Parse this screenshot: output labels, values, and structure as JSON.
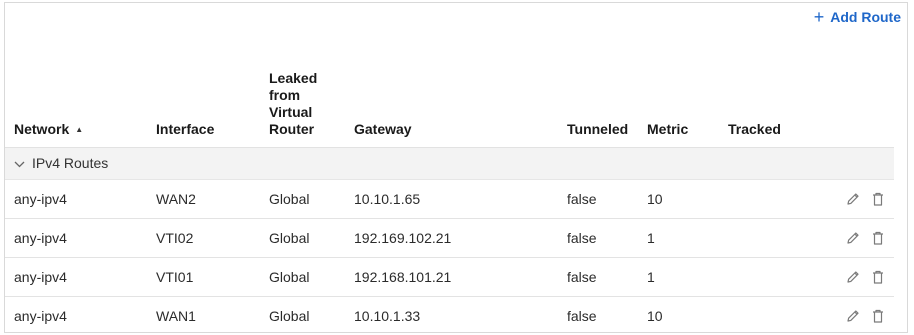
{
  "toolbar": {
    "add_route_label": "Add Route"
  },
  "columns": {
    "network": "Network",
    "interface": "Interface",
    "leaked": "Leaked from Virtual Router",
    "gateway": "Gateway",
    "tunneled": "Tunneled",
    "metric": "Metric",
    "tracked": "Tracked"
  },
  "sort": {
    "column": "network",
    "direction": "ascending"
  },
  "group": {
    "label": "IPv4 Routes",
    "expanded": true
  },
  "rows": [
    {
      "network": "any-ipv4",
      "interface": "WAN2",
      "leaked": "Global",
      "gateway": "10.10.1.65",
      "tunneled": "false",
      "metric": "10",
      "tracked": ""
    },
    {
      "network": "any-ipv4",
      "interface": "VTI02",
      "leaked": "Global",
      "gateway": "192.169.102.21",
      "tunneled": "false",
      "metric": "1",
      "tracked": ""
    },
    {
      "network": "any-ipv4",
      "interface": "VTI01",
      "leaked": "Global",
      "gateway": "192.168.101.21",
      "tunneled": "false",
      "metric": "1",
      "tracked": ""
    },
    {
      "network": "any-ipv4",
      "interface": "WAN1",
      "leaked": "Global",
      "gateway": "10.10.1.33",
      "tunneled": "false",
      "metric": "10",
      "tracked": ""
    }
  ],
  "icons": {
    "add": "plus-icon",
    "sort": "sort-asc-icon",
    "expand": "chevron-down-icon",
    "edit": "pencil-icon",
    "delete": "trash-icon"
  },
  "colors": {
    "accent": "#1f67c9",
    "group_bg": "#f3f3f3",
    "border": "#e3e3e3",
    "icon": "#7a7a7a"
  }
}
